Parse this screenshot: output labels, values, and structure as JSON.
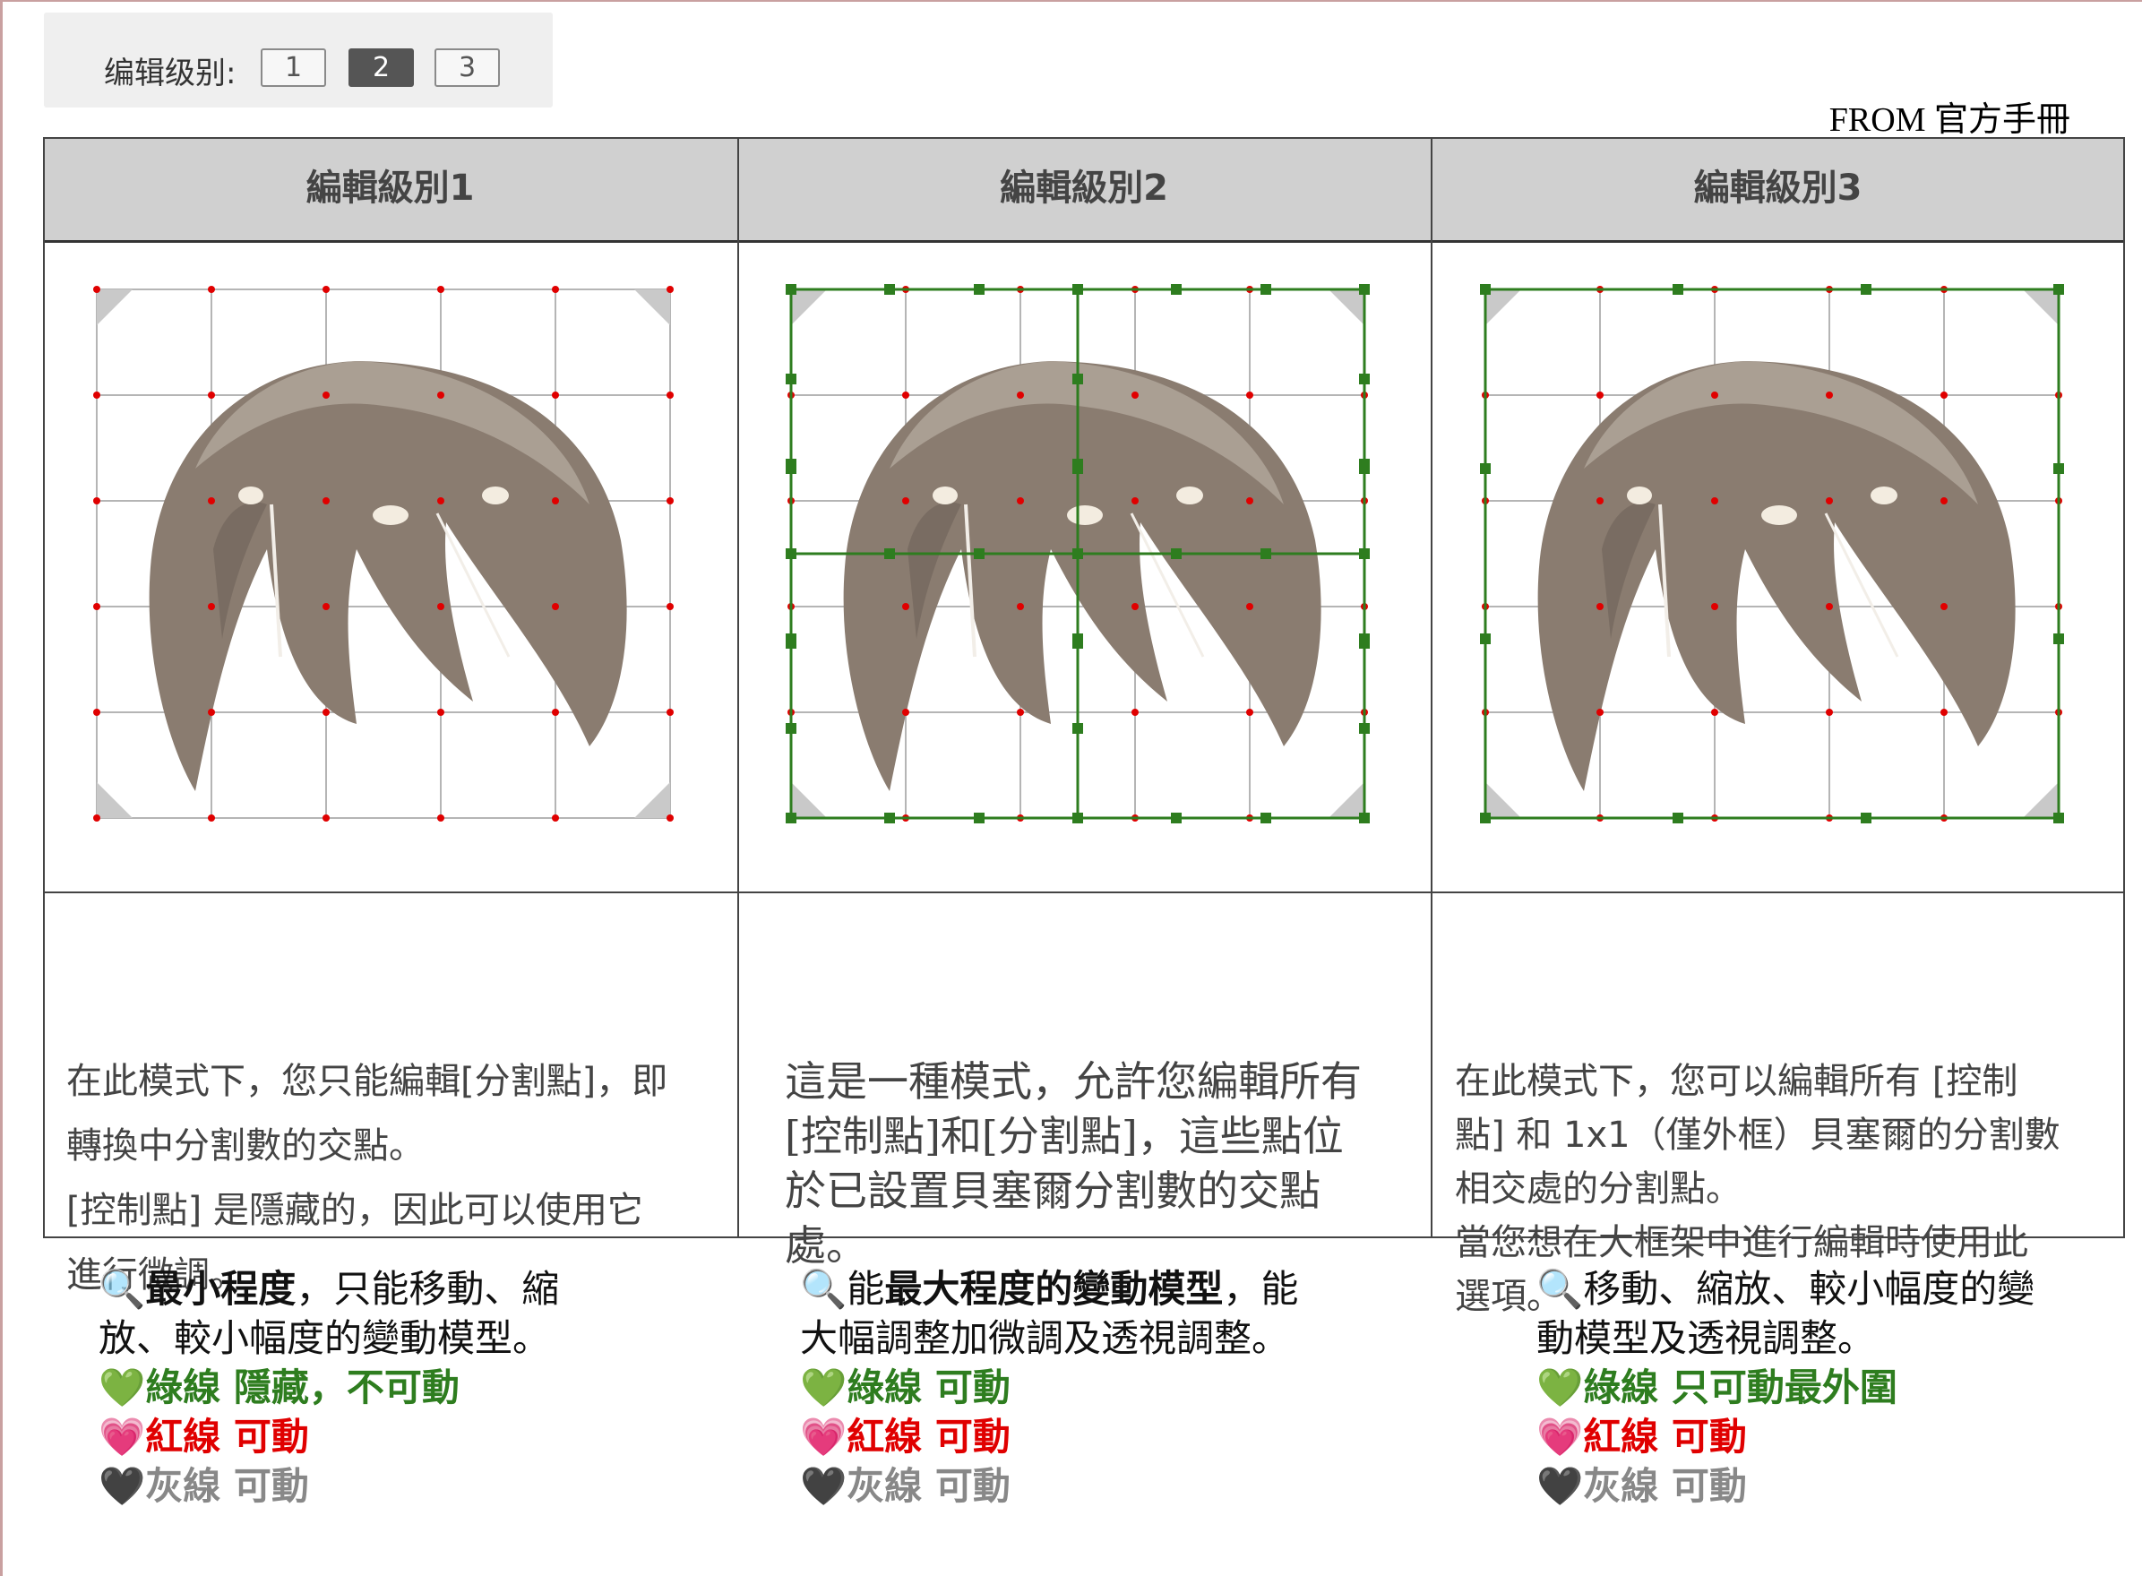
{
  "toolbar": {
    "label": "编辑级别:",
    "levels": [
      "1",
      "2",
      "3"
    ],
    "active_level": "2"
  },
  "source_note": "FROM 官方手冊",
  "table": {
    "columns": [
      {
        "header": "編輯級別1",
        "description": [
          "在此模式下，您只能編輯[分割點]，即",
          "轉換中分割數的交點。",
          "[控制點] 是隱藏的，因此可以使用它",
          "進行微調。"
        ]
      },
      {
        "header": "編輯級別2",
        "description": [
          "這是一種模式，允許您編輯所有",
          "[控制點]和[分割點]，這些點位",
          "於已設置貝塞爾分割數的交點",
          "處。"
        ]
      },
      {
        "header": "編輯級別3",
        "description": [
          "在此模式下，您可以編輯所有 [控制",
          "點] 和 1x1（僅外框）貝塞爾的分割數",
          "相交處的分割點。",
          "當您想在大框架中進行編輯時使用此",
          "選項。"
        ]
      }
    ]
  },
  "notes": [
    {
      "icon": "🔍",
      "intro_bold": "最小程度",
      "intro_rest_line1": "，只能移動、縮",
      "intro_line2": "放、較小幅度的變動模型。",
      "green_icon": "💚",
      "green": "綠線 隱藏，不可動",
      "red_icon": "💗",
      "red": "紅線 可動",
      "gray_icon": "🖤",
      "gray": "灰線 可動"
    },
    {
      "icon": "🔍",
      "intro_pre": "能",
      "intro_bold": "最大程度的變動模型",
      "intro_rest_line1": "，能",
      "intro_line2": "大幅調整加微調及透視調整。",
      "green_icon": "💚",
      "green": "綠線 可動",
      "red_icon": "💗",
      "red": "紅線 可動",
      "gray_icon": "🖤",
      "gray": "灰線 可動"
    },
    {
      "icon": "🔍",
      "intro_rest_line1": "移動、縮放、較小幅度的變",
      "intro_line2": "動模型及透視調整。",
      "green_icon": "💚",
      "green": "綠線 只可動最外圍",
      "red_icon": "💗",
      "red": "紅線 可動",
      "gray_icon": "🖤",
      "gray": "灰線 可動"
    }
  ],
  "colors": {
    "green_line": "#2e7d1f",
    "red_line": "#e00000",
    "gray_line": "#888888",
    "header_bg": "#d0d0d0",
    "hair": "#8a7c70"
  }
}
